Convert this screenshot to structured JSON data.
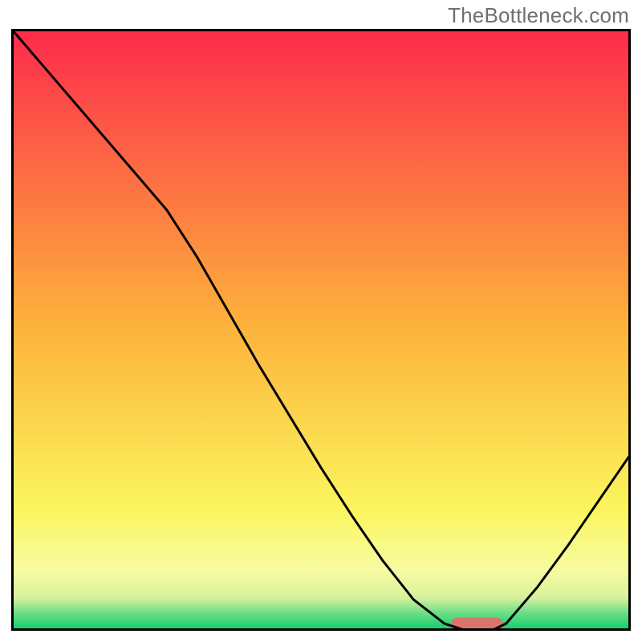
{
  "watermark": "TheBottleneck.com",
  "chart_data": {
    "type": "line",
    "title": "",
    "xlabel": "",
    "ylabel": "",
    "xlim": [
      0,
      100
    ],
    "ylim": [
      0,
      100
    ],
    "grid": false,
    "legend": null,
    "series": [
      {
        "name": "bottleneck-curve",
        "x": [
          0,
          5,
          10,
          15,
          20,
          25,
          30,
          35,
          40,
          45,
          50,
          55,
          60,
          65,
          70,
          73,
          78,
          80,
          85,
          90,
          95,
          100
        ],
        "y": [
          100,
          94,
          88,
          82,
          76,
          70,
          62,
          53,
          44,
          35.5,
          27,
          19,
          11.5,
          5,
          1,
          0,
          0,
          1,
          7,
          14,
          21.5,
          29
        ]
      }
    ],
    "marker": {
      "name": "highlight-pill",
      "x_range": [
        71,
        79.5
      ],
      "y": 0,
      "color": "#d9746c"
    },
    "background_gradient": {
      "stops": [
        {
          "offset": 0.0,
          "color": "#fd2a4b"
        },
        {
          "offset": 0.5,
          "color": "#fdb43c"
        },
        {
          "offset": 0.8,
          "color": "#fbf65e"
        },
        {
          "offset": 0.9,
          "color": "#f7fba2"
        },
        {
          "offset": 0.945,
          "color": "#d7f29c"
        },
        {
          "offset": 0.97,
          "color": "#6ddf86"
        },
        {
          "offset": 1.0,
          "color": "#0ccb6a"
        }
      ]
    },
    "colors": {
      "axis": "#000000",
      "curve": "#000000",
      "marker": "#d9746c"
    }
  }
}
